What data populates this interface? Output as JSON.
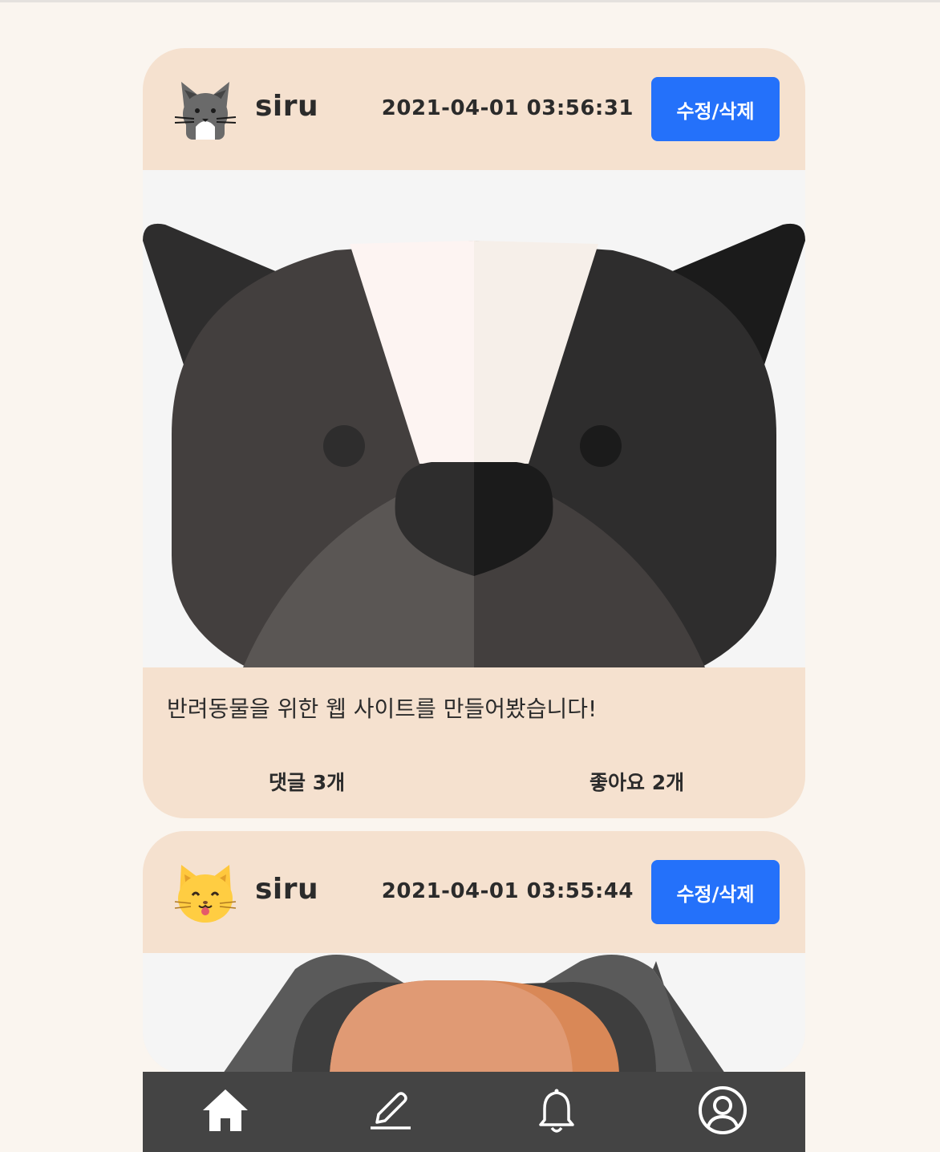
{
  "posts": [
    {
      "username": "siru",
      "timestamp": "2021-04-01 03:56:31",
      "edit_label": "수정/삭제",
      "text": "반려동물을 위한 웹 사이트를 만들어봤습니다!",
      "comments_label": "댓글 3개",
      "likes_label": "좋아요 2개",
      "avatar_icon": "tuxedo-cat-icon",
      "image": "dog-face-illustration"
    },
    {
      "username": "siru",
      "timestamp": "2021-04-01 03:55:44",
      "edit_label": "수정/삭제",
      "avatar_icon": "smiling-cat-emoji-icon",
      "image": "dog-face-illustration-partial"
    }
  ],
  "bottom_nav": {
    "items": [
      "home-icon",
      "write-icon",
      "bell-icon",
      "profile-icon"
    ]
  },
  "colors": {
    "background": "#faf5ef",
    "card": "#f5e1cf",
    "accent": "#2471fa",
    "nav": "#444444"
  }
}
